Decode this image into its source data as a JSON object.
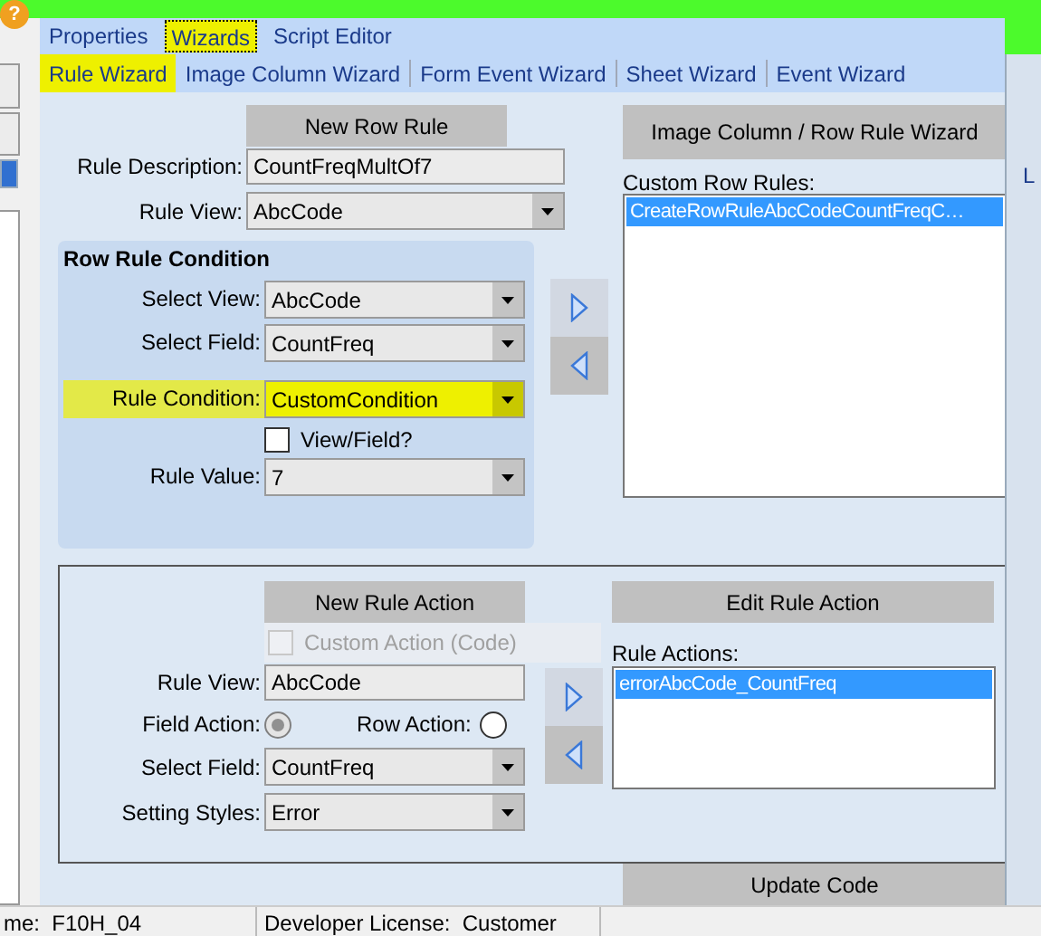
{
  "help_icon": "?",
  "top_tabs": [
    {
      "label": "Properties",
      "selected": false
    },
    {
      "label": "Wizards",
      "selected": true
    },
    {
      "label": "Script Editor",
      "selected": false
    }
  ],
  "wizard_tabs": [
    {
      "label": "Rule Wizard",
      "selected": true
    },
    {
      "label": "Image Column Wizard",
      "selected": false
    },
    {
      "label": "Form Event Wizard",
      "selected": false
    },
    {
      "label": "Sheet Wizard",
      "selected": false
    },
    {
      "label": "Event Wizard",
      "selected": false
    }
  ],
  "rule": {
    "new_button": "New Row Rule",
    "fields": [
      {
        "kind": "text",
        "label": "Rule Description:",
        "value": "CountFreqMultOf7"
      },
      {
        "kind": "select",
        "label": "Rule View:",
        "value": "AbcCode"
      }
    ]
  },
  "condition": {
    "title": "Row Rule Condition",
    "rows": [
      {
        "kind": "select",
        "label": "Select View:",
        "value": "AbcCode",
        "highlighted": false
      },
      {
        "kind": "select",
        "label": "Select Field:",
        "value": "CountFreq",
        "highlighted": false
      },
      {
        "kind": "select",
        "label": "Rule Condition:",
        "value": "CustomCondition",
        "highlighted": true
      },
      {
        "kind": "checkbox",
        "label": "View/Field?",
        "checked": false
      },
      {
        "kind": "select",
        "label": "Rule Value:",
        "value": "7",
        "highlighted": false
      }
    ]
  },
  "custom_rules": {
    "button": "Image Column / Row Rule Wizard",
    "label": "Custom Row Rules:",
    "items": [
      {
        "text": "CreateRowRuleAbcCodeCountFreqC…",
        "selected": true
      }
    ]
  },
  "action": {
    "new_button": "New Rule Action",
    "custom_action": {
      "label": "Custom Action (Code)",
      "checked": false,
      "disabled": true
    },
    "rows": [
      {
        "kind": "text",
        "label": "Rule View:",
        "value": "AbcCode"
      },
      {
        "kind": "radios",
        "options": [
          {
            "label": "Field Action:",
            "selected": true,
            "disabled": true
          },
          {
            "label": "Row Action:",
            "selected": false,
            "disabled": false
          }
        ]
      },
      {
        "kind": "select",
        "label": "Select Field:",
        "value": "CountFreq"
      },
      {
        "kind": "select",
        "label": "Setting Styles:",
        "value": "Error"
      }
    ],
    "edit_button": "Edit Rule Action",
    "list_label": "Rule Actions:",
    "items": [
      {
        "text": "errorAbcCode_CountFreq",
        "selected": true
      }
    ]
  },
  "update_button": "Update Code",
  "right_edge_text": "L",
  "status_bar": [
    "me:  F10H_04",
    "Developer License:  Customer"
  ]
}
